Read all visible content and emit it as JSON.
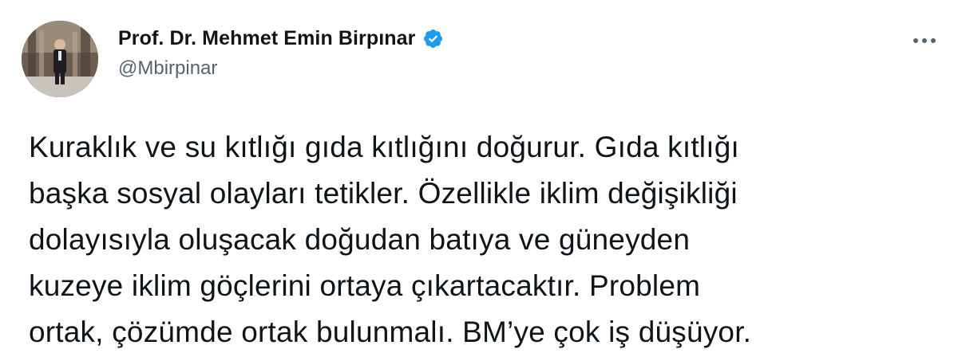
{
  "author": {
    "display_name": "Prof. Dr. Mehmet Emin Birpınar",
    "handle": "@Mbirpinar",
    "verified": true,
    "verified_badge_color": "#1d9bf0",
    "avatar_icon": "profile-photo"
  },
  "menu": {
    "icon": "more-horizontal-icon"
  },
  "tweet": {
    "lines": [
      "Kuraklık ve su kıtlığı gıda kıtlığını doğurur. Gıda kıtlığı",
      "başka sosyal olayları tetikler. Özellikle iklim değişikliği",
      "dolayısıyla oluşacak doğudan batıya ve güneyden",
      "kuzeye iklim göçlerini ortaya çıkartacaktır. Problem",
      "ortak, çözümde ortak bulunmalı. BM’ye çok iş düşüyor."
    ]
  },
  "colors": {
    "text_primary": "#0f1419",
    "text_secondary": "#536471",
    "accent": "#1d9bf0"
  }
}
